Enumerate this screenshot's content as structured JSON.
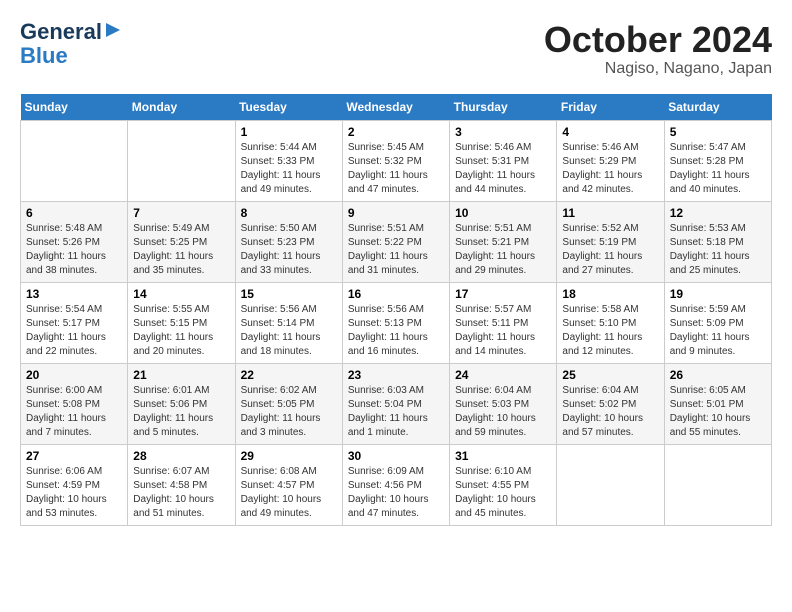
{
  "header": {
    "logo_line1": "General",
    "logo_line2": "Blue",
    "month": "October 2024",
    "location": "Nagiso, Nagano, Japan"
  },
  "weekdays": [
    "Sunday",
    "Monday",
    "Tuesday",
    "Wednesday",
    "Thursday",
    "Friday",
    "Saturday"
  ],
  "weeks": [
    [
      {
        "day": "",
        "sunrise": "",
        "sunset": "",
        "daylight": ""
      },
      {
        "day": "",
        "sunrise": "",
        "sunset": "",
        "daylight": ""
      },
      {
        "day": "1",
        "sunrise": "Sunrise: 5:44 AM",
        "sunset": "Sunset: 5:33 PM",
        "daylight": "Daylight: 11 hours and 49 minutes."
      },
      {
        "day": "2",
        "sunrise": "Sunrise: 5:45 AM",
        "sunset": "Sunset: 5:32 PM",
        "daylight": "Daylight: 11 hours and 47 minutes."
      },
      {
        "day": "3",
        "sunrise": "Sunrise: 5:46 AM",
        "sunset": "Sunset: 5:31 PM",
        "daylight": "Daylight: 11 hours and 44 minutes."
      },
      {
        "day": "4",
        "sunrise": "Sunrise: 5:46 AM",
        "sunset": "Sunset: 5:29 PM",
        "daylight": "Daylight: 11 hours and 42 minutes."
      },
      {
        "day": "5",
        "sunrise": "Sunrise: 5:47 AM",
        "sunset": "Sunset: 5:28 PM",
        "daylight": "Daylight: 11 hours and 40 minutes."
      }
    ],
    [
      {
        "day": "6",
        "sunrise": "Sunrise: 5:48 AM",
        "sunset": "Sunset: 5:26 PM",
        "daylight": "Daylight: 11 hours and 38 minutes."
      },
      {
        "day": "7",
        "sunrise": "Sunrise: 5:49 AM",
        "sunset": "Sunset: 5:25 PM",
        "daylight": "Daylight: 11 hours and 35 minutes."
      },
      {
        "day": "8",
        "sunrise": "Sunrise: 5:50 AM",
        "sunset": "Sunset: 5:23 PM",
        "daylight": "Daylight: 11 hours and 33 minutes."
      },
      {
        "day": "9",
        "sunrise": "Sunrise: 5:51 AM",
        "sunset": "Sunset: 5:22 PM",
        "daylight": "Daylight: 11 hours and 31 minutes."
      },
      {
        "day": "10",
        "sunrise": "Sunrise: 5:51 AM",
        "sunset": "Sunset: 5:21 PM",
        "daylight": "Daylight: 11 hours and 29 minutes."
      },
      {
        "day": "11",
        "sunrise": "Sunrise: 5:52 AM",
        "sunset": "Sunset: 5:19 PM",
        "daylight": "Daylight: 11 hours and 27 minutes."
      },
      {
        "day": "12",
        "sunrise": "Sunrise: 5:53 AM",
        "sunset": "Sunset: 5:18 PM",
        "daylight": "Daylight: 11 hours and 25 minutes."
      }
    ],
    [
      {
        "day": "13",
        "sunrise": "Sunrise: 5:54 AM",
        "sunset": "Sunset: 5:17 PM",
        "daylight": "Daylight: 11 hours and 22 minutes."
      },
      {
        "day": "14",
        "sunrise": "Sunrise: 5:55 AM",
        "sunset": "Sunset: 5:15 PM",
        "daylight": "Daylight: 11 hours and 20 minutes."
      },
      {
        "day": "15",
        "sunrise": "Sunrise: 5:56 AM",
        "sunset": "Sunset: 5:14 PM",
        "daylight": "Daylight: 11 hours and 18 minutes."
      },
      {
        "day": "16",
        "sunrise": "Sunrise: 5:56 AM",
        "sunset": "Sunset: 5:13 PM",
        "daylight": "Daylight: 11 hours and 16 minutes."
      },
      {
        "day": "17",
        "sunrise": "Sunrise: 5:57 AM",
        "sunset": "Sunset: 5:11 PM",
        "daylight": "Daylight: 11 hours and 14 minutes."
      },
      {
        "day": "18",
        "sunrise": "Sunrise: 5:58 AM",
        "sunset": "Sunset: 5:10 PM",
        "daylight": "Daylight: 11 hours and 12 minutes."
      },
      {
        "day": "19",
        "sunrise": "Sunrise: 5:59 AM",
        "sunset": "Sunset: 5:09 PM",
        "daylight": "Daylight: 11 hours and 9 minutes."
      }
    ],
    [
      {
        "day": "20",
        "sunrise": "Sunrise: 6:00 AM",
        "sunset": "Sunset: 5:08 PM",
        "daylight": "Daylight: 11 hours and 7 minutes."
      },
      {
        "day": "21",
        "sunrise": "Sunrise: 6:01 AM",
        "sunset": "Sunset: 5:06 PM",
        "daylight": "Daylight: 11 hours and 5 minutes."
      },
      {
        "day": "22",
        "sunrise": "Sunrise: 6:02 AM",
        "sunset": "Sunset: 5:05 PM",
        "daylight": "Daylight: 11 hours and 3 minutes."
      },
      {
        "day": "23",
        "sunrise": "Sunrise: 6:03 AM",
        "sunset": "Sunset: 5:04 PM",
        "daylight": "Daylight: 11 hours and 1 minute."
      },
      {
        "day": "24",
        "sunrise": "Sunrise: 6:04 AM",
        "sunset": "Sunset: 5:03 PM",
        "daylight": "Daylight: 10 hours and 59 minutes."
      },
      {
        "day": "25",
        "sunrise": "Sunrise: 6:04 AM",
        "sunset": "Sunset: 5:02 PM",
        "daylight": "Daylight: 10 hours and 57 minutes."
      },
      {
        "day": "26",
        "sunrise": "Sunrise: 6:05 AM",
        "sunset": "Sunset: 5:01 PM",
        "daylight": "Daylight: 10 hours and 55 minutes."
      }
    ],
    [
      {
        "day": "27",
        "sunrise": "Sunrise: 6:06 AM",
        "sunset": "Sunset: 4:59 PM",
        "daylight": "Daylight: 10 hours and 53 minutes."
      },
      {
        "day": "28",
        "sunrise": "Sunrise: 6:07 AM",
        "sunset": "Sunset: 4:58 PM",
        "daylight": "Daylight: 10 hours and 51 minutes."
      },
      {
        "day": "29",
        "sunrise": "Sunrise: 6:08 AM",
        "sunset": "Sunset: 4:57 PM",
        "daylight": "Daylight: 10 hours and 49 minutes."
      },
      {
        "day": "30",
        "sunrise": "Sunrise: 6:09 AM",
        "sunset": "Sunset: 4:56 PM",
        "daylight": "Daylight: 10 hours and 47 minutes."
      },
      {
        "day": "31",
        "sunrise": "Sunrise: 6:10 AM",
        "sunset": "Sunset: 4:55 PM",
        "daylight": "Daylight: 10 hours and 45 minutes."
      },
      {
        "day": "",
        "sunrise": "",
        "sunset": "",
        "daylight": ""
      },
      {
        "day": "",
        "sunrise": "",
        "sunset": "",
        "daylight": ""
      }
    ]
  ]
}
